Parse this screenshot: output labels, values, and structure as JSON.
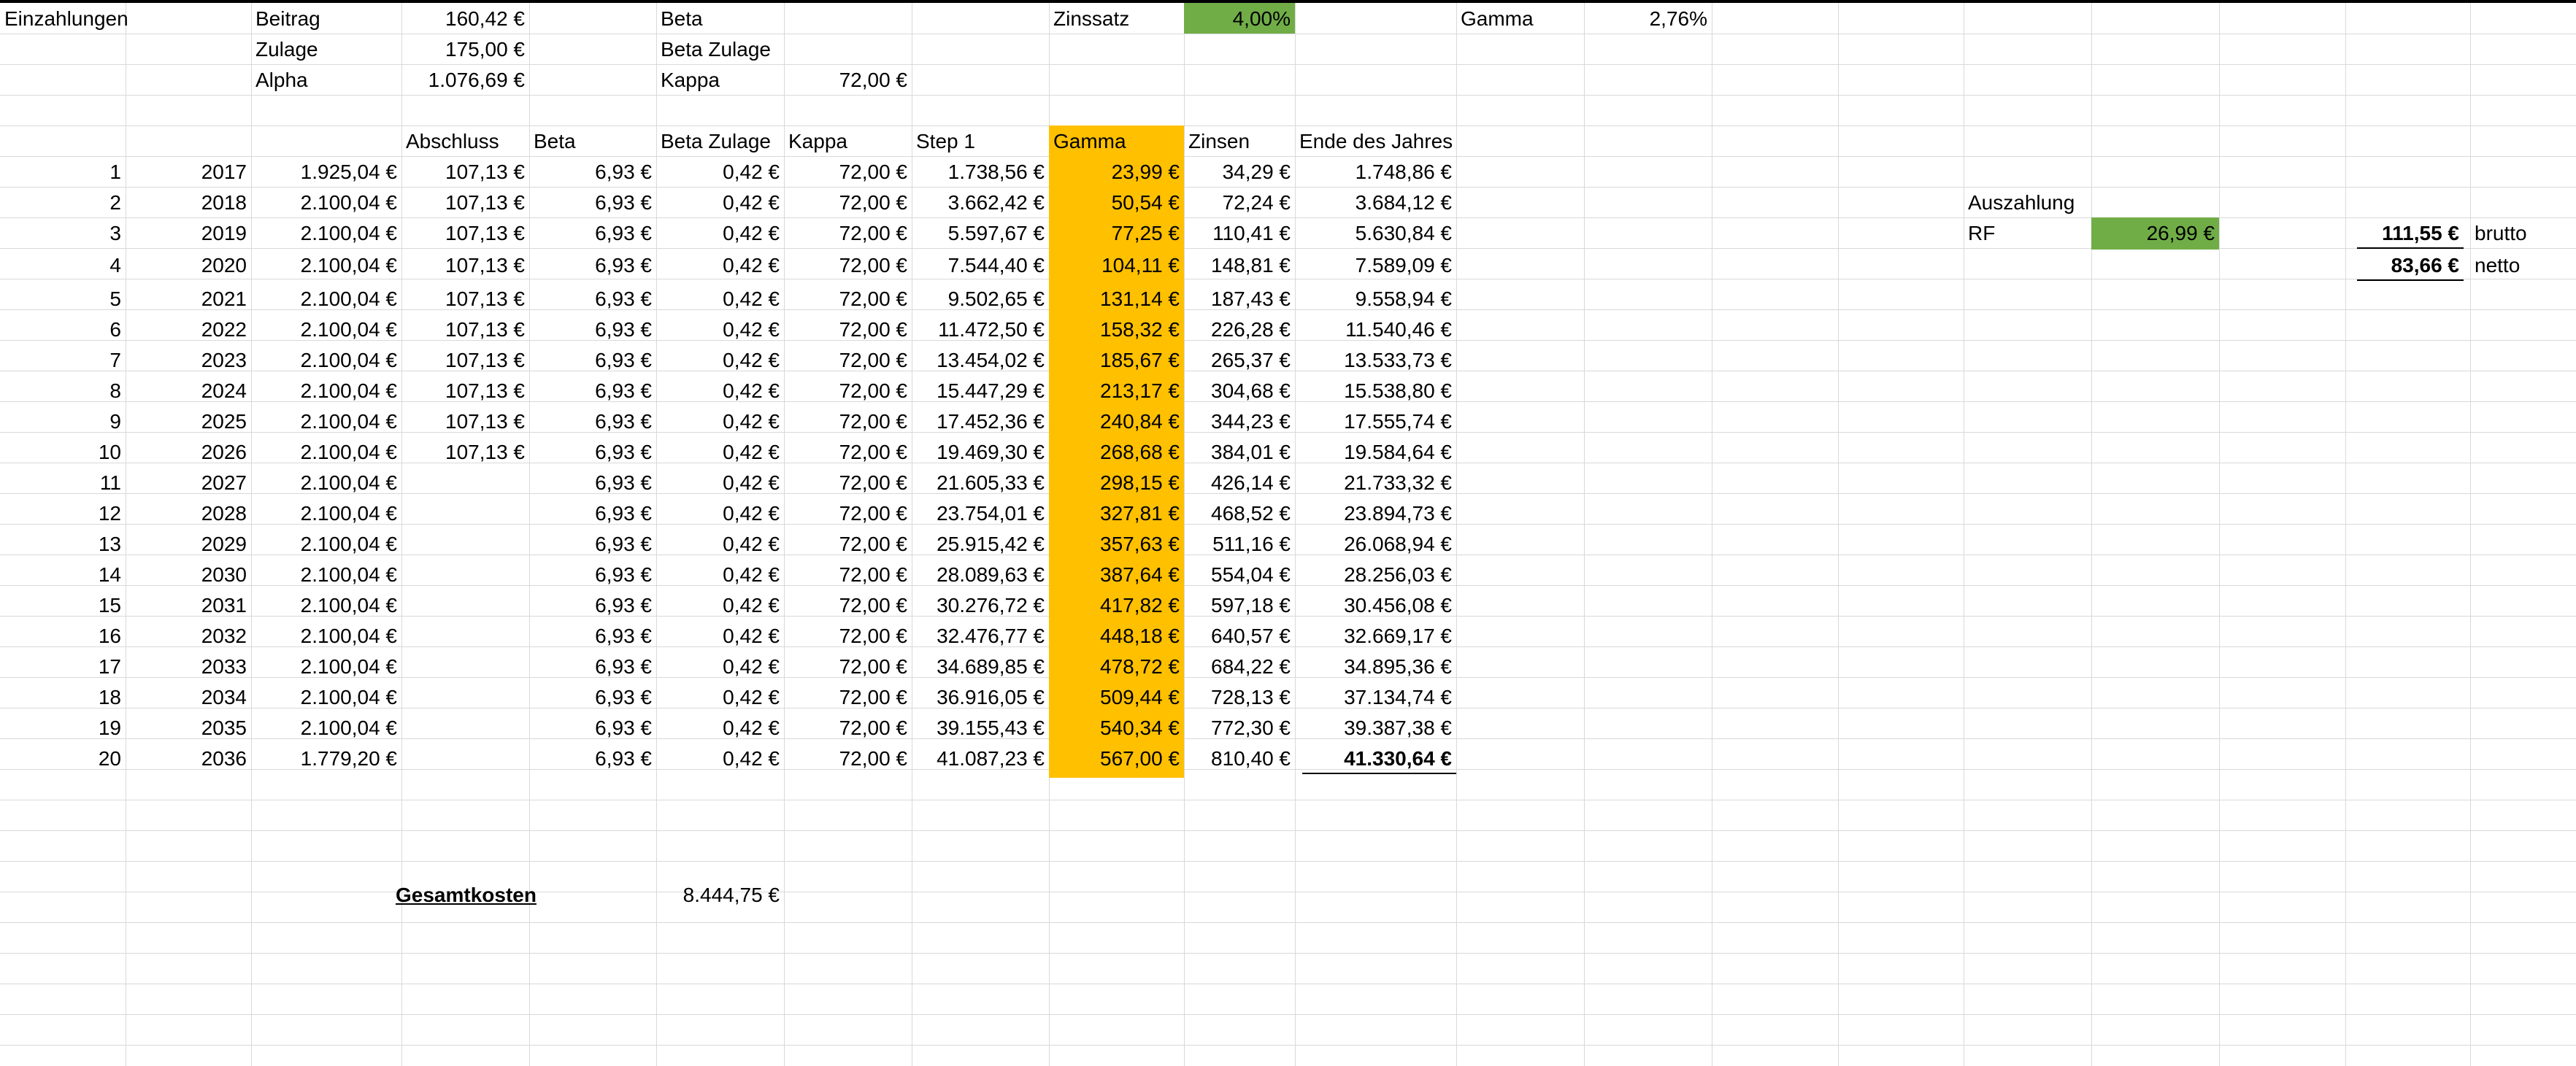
{
  "top_block": {
    "einzahlungen": "Einzahlungen",
    "beitrag_label": "Beitrag",
    "beitrag_value": "160,42 €",
    "zulage_label": "Zulage",
    "zulage_value": "175,00 €",
    "alpha_label": "Alpha",
    "alpha_value": "1.076,69 €",
    "beta_label": "Beta",
    "beta_zulage_label": "Beta Zulage",
    "kappa_label": "Kappa",
    "kappa_value": "72,00 €",
    "zinssatz_label": "Zinssatz",
    "zinssatz_value": "4,00%",
    "gamma_label": "Gamma",
    "gamma_value": "2,76%"
  },
  "table": {
    "headers": [
      "Abschluss",
      "Beta",
      "Beta Zulage",
      "Kappa",
      "Step 1",
      "Gamma",
      "Zinsen",
      "Ende des Jahres"
    ],
    "rows": [
      [
        "1",
        "2017",
        "1.925,04 €",
        "107,13 €",
        "6,93 €",
        "0,42 €",
        "72,00 €",
        "1.738,56 €",
        "23,99 €",
        "34,29 €",
        "1.748,86 €"
      ],
      [
        "2",
        "2018",
        "2.100,04 €",
        "107,13 €",
        "6,93 €",
        "0,42 €",
        "72,00 €",
        "3.662,42 €",
        "50,54 €",
        "72,24 €",
        "3.684,12 €"
      ],
      [
        "3",
        "2019",
        "2.100,04 €",
        "107,13 €",
        "6,93 €",
        "0,42 €",
        "72,00 €",
        "5.597,67 €",
        "77,25 €",
        "110,41 €",
        "5.630,84 €"
      ],
      [
        "4",
        "2020",
        "2.100,04 €",
        "107,13 €",
        "6,93 €",
        "0,42 €",
        "72,00 €",
        "7.544,40 €",
        "104,11 €",
        "148,81 €",
        "7.589,09 €"
      ],
      [
        "5",
        "2021",
        "2.100,04 €",
        "107,13 €",
        "6,93 €",
        "0,42 €",
        "72,00 €",
        "9.502,65 €",
        "131,14 €",
        "187,43 €",
        "9.558,94 €"
      ],
      [
        "6",
        "2022",
        "2.100,04 €",
        "107,13 €",
        "6,93 €",
        "0,42 €",
        "72,00 €",
        "11.472,50 €",
        "158,32 €",
        "226,28 €",
        "11.540,46 €"
      ],
      [
        "7",
        "2023",
        "2.100,04 €",
        "107,13 €",
        "6,93 €",
        "0,42 €",
        "72,00 €",
        "13.454,02 €",
        "185,67 €",
        "265,37 €",
        "13.533,73 €"
      ],
      [
        "8",
        "2024",
        "2.100,04 €",
        "107,13 €",
        "6,93 €",
        "0,42 €",
        "72,00 €",
        "15.447,29 €",
        "213,17 €",
        "304,68 €",
        "15.538,80 €"
      ],
      [
        "9",
        "2025",
        "2.100,04 €",
        "107,13 €",
        "6,93 €",
        "0,42 €",
        "72,00 €",
        "17.452,36 €",
        "240,84 €",
        "344,23 €",
        "17.555,74 €"
      ],
      [
        "10",
        "2026",
        "2.100,04 €",
        "107,13 €",
        "6,93 €",
        "0,42 €",
        "72,00 €",
        "19.469,30 €",
        "268,68 €",
        "384,01 €",
        "19.584,64 €"
      ],
      [
        "11",
        "2027",
        "2.100,04 €",
        "",
        "6,93 €",
        "0,42 €",
        "72,00 €",
        "21.605,33 €",
        "298,15 €",
        "426,14 €",
        "21.733,32 €"
      ],
      [
        "12",
        "2028",
        "2.100,04 €",
        "",
        "6,93 €",
        "0,42 €",
        "72,00 €",
        "23.754,01 €",
        "327,81 €",
        "468,52 €",
        "23.894,73 €"
      ],
      [
        "13",
        "2029",
        "2.100,04 €",
        "",
        "6,93 €",
        "0,42 €",
        "72,00 €",
        "25.915,42 €",
        "357,63 €",
        "511,16 €",
        "26.068,94 €"
      ],
      [
        "14",
        "2030",
        "2.100,04 €",
        "",
        "6,93 €",
        "0,42 €",
        "72,00 €",
        "28.089,63 €",
        "387,64 €",
        "554,04 €",
        "28.256,03 €"
      ],
      [
        "15",
        "2031",
        "2.100,04 €",
        "",
        "6,93 €",
        "0,42 €",
        "72,00 €",
        "30.276,72 €",
        "417,82 €",
        "597,18 €",
        "30.456,08 €"
      ],
      [
        "16",
        "2032",
        "2.100,04 €",
        "",
        "6,93 €",
        "0,42 €",
        "72,00 €",
        "32.476,77 €",
        "448,18 €",
        "640,57 €",
        "32.669,17 €"
      ],
      [
        "17",
        "2033",
        "2.100,04 €",
        "",
        "6,93 €",
        "0,42 €",
        "72,00 €",
        "34.689,85 €",
        "478,72 €",
        "684,22 €",
        "34.895,36 €"
      ],
      [
        "18",
        "2034",
        "2.100,04 €",
        "",
        "6,93 €",
        "0,42 €",
        "72,00 €",
        "36.916,05 €",
        "509,44 €",
        "728,13 €",
        "37.134,74 €"
      ],
      [
        "19",
        "2035",
        "2.100,04 €",
        "",
        "6,93 €",
        "0,42 €",
        "72,00 €",
        "39.155,43 €",
        "540,34 €",
        "772,30 €",
        "39.387,38 €"
      ],
      [
        "20",
        "2036",
        "1.779,20 €",
        "",
        "6,93 €",
        "0,42 €",
        "72,00 €",
        "41.087,23 €",
        "567,00 €",
        "810,40 €",
        "41.330,64 €"
      ]
    ]
  },
  "gesamtkosten": {
    "label": "Gesamtkosten",
    "value": "8.444,75 €"
  },
  "auszahlung": {
    "label": "Auszahlung",
    "rf_label": "RF",
    "rf_value": "26,99 €",
    "brutto_value": "111,55 €",
    "brutto_label": "brutto",
    "netto_value": "83,66 €",
    "netto_label": "netto"
  },
  "colors": {
    "green": "#70AD47",
    "orange": "#FFC000",
    "gridline": "#d9d9d9"
  }
}
